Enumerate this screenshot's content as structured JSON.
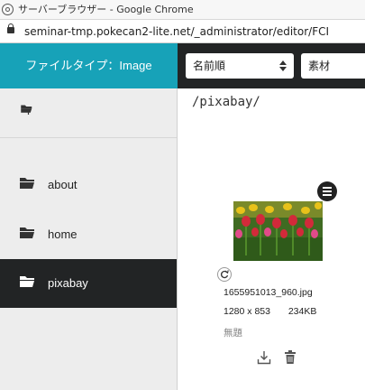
{
  "window": {
    "title": "サーバーブラウザー - Google Chrome",
    "url": "seminar-tmp.pokecan2-lite.net/_administrator/editor/FCI"
  },
  "header": {
    "filetype_label": "ファイルタイプ：Image",
    "sort_select": "名前順",
    "type_select": "素材"
  },
  "sidebar": {
    "items": [
      {
        "label": "",
        "icon": "folder-up-icon"
      },
      {
        "label": "about",
        "icon": "folder-icon"
      },
      {
        "label": "home",
        "icon": "folder-icon"
      },
      {
        "label": "pixabay",
        "icon": "folder-icon",
        "active": true
      }
    ]
  },
  "main": {
    "path": "/pixabay/",
    "file": {
      "name": "1655951013_960.jpg",
      "dimensions": "1280 x 853",
      "size": "234KB",
      "caption": "無題"
    }
  },
  "colors": {
    "accent": "#17a2b8",
    "dark": "#222425",
    "sidebar_bg": "#ededed"
  }
}
